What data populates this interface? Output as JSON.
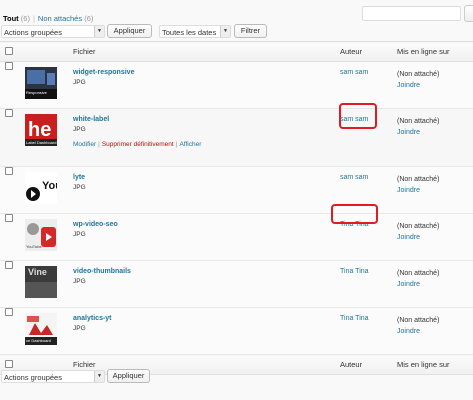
{
  "filters": {
    "all_label": "Tout",
    "all_count": "(6)",
    "unattached_label": "Non attachés",
    "unattached_count": "(6)",
    "separator": "|"
  },
  "tablenav_top": {
    "bulk_actions": "Actions groupées",
    "apply": "Appliquer",
    "dates": "Toutes les dates",
    "filter": "Filtrer"
  },
  "columns": {
    "file": "Fichier",
    "author": "Auteur",
    "attached": "Mis en ligne sur"
  },
  "rows": [
    {
      "title": "widget-responsive",
      "type": "JPG",
      "author": "sam sam",
      "attached": "(Non attaché)",
      "attach_link": "Joindre",
      "thumb_label": "Responsive"
    },
    {
      "title": "white-label",
      "type": "JPG",
      "author": "sam sam",
      "attached": "(Non attaché)",
      "attach_link": "Joindre",
      "thumb_label": "Label Dashboard",
      "actions": {
        "edit": "Modifier",
        "delete": "Supprimer définitivement",
        "view": "Afficher"
      }
    },
    {
      "title": "lyte",
      "type": "JPG",
      "author": "sam sam",
      "attached": "(Non attaché)",
      "attach_link": "Joindre",
      "thumb_label": "You"
    },
    {
      "title": "wp-video-seo",
      "type": "JPG",
      "author": "Tina Tina",
      "attached": "(Non attaché)",
      "attach_link": "Joindre",
      "thumb_label": "YouTube"
    },
    {
      "title": "video-thumbnails",
      "type": "JPG",
      "author": "Tina Tina",
      "attached": "(Non attaché)",
      "attach_link": "Joindre",
      "thumb_label": "Vine"
    },
    {
      "title": "analytics-yt",
      "type": "JPG",
      "author": "Tina Tina",
      "attached": "(Non attaché)",
      "attach_link": "Joindre",
      "thumb_label": "ce Dashboard"
    }
  ],
  "tablenav_bottom": {
    "bulk_actions": "Actions groupées",
    "apply": "Appliquer"
  },
  "colors": {
    "link": "#21759b",
    "delete": "#bc0b0b",
    "highlight": "#e01b24"
  }
}
